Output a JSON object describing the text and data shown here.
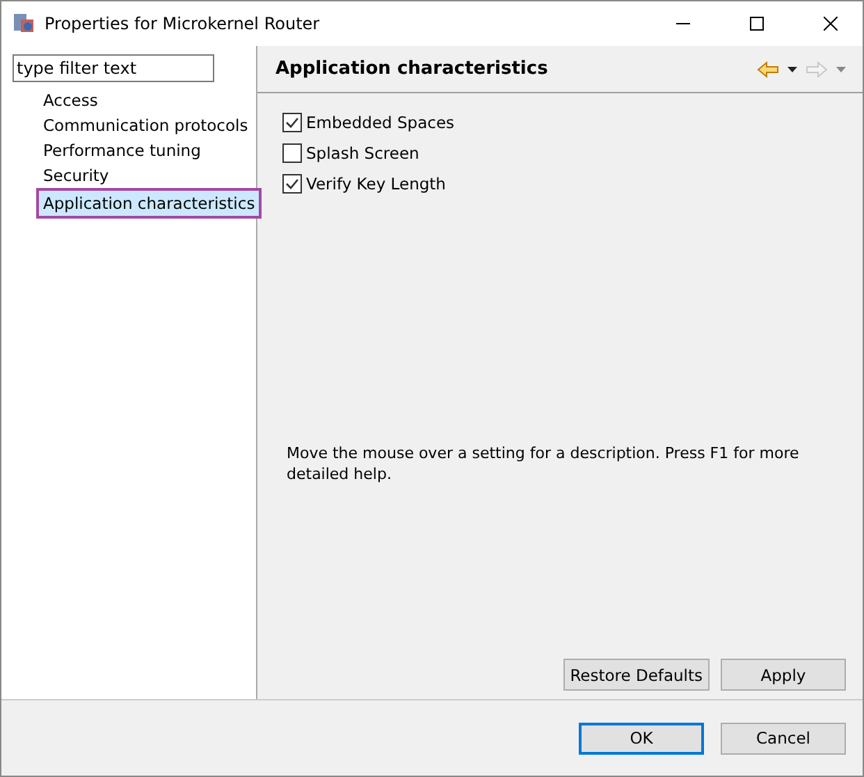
{
  "window": {
    "title": "Properties for Microkernel Router"
  },
  "filter": {
    "placeholder": "type filter text"
  },
  "nav": [
    {
      "label": "Access",
      "selected": false
    },
    {
      "label": "Communication protocols",
      "selected": false
    },
    {
      "label": "Performance tuning",
      "selected": false
    },
    {
      "label": "Security",
      "selected": false
    },
    {
      "label": "Application characteristics",
      "selected": true
    }
  ],
  "page": {
    "title": "Application characteristics",
    "options": [
      {
        "label": "Embedded Spaces",
        "checked": true
      },
      {
        "label": "Splash Screen",
        "checked": false
      },
      {
        "label": "Verify Key Length",
        "checked": true
      }
    ],
    "description": "Move the mouse over a setting for a description. Press F1 for more detailed help.",
    "buttons": [
      {
        "label": "Restore Defaults"
      },
      {
        "label": "Apply"
      }
    ]
  },
  "dialog_buttons": [
    {
      "label": "OK",
      "focused": true
    },
    {
      "label": "Cancel",
      "focused": false
    }
  ]
}
